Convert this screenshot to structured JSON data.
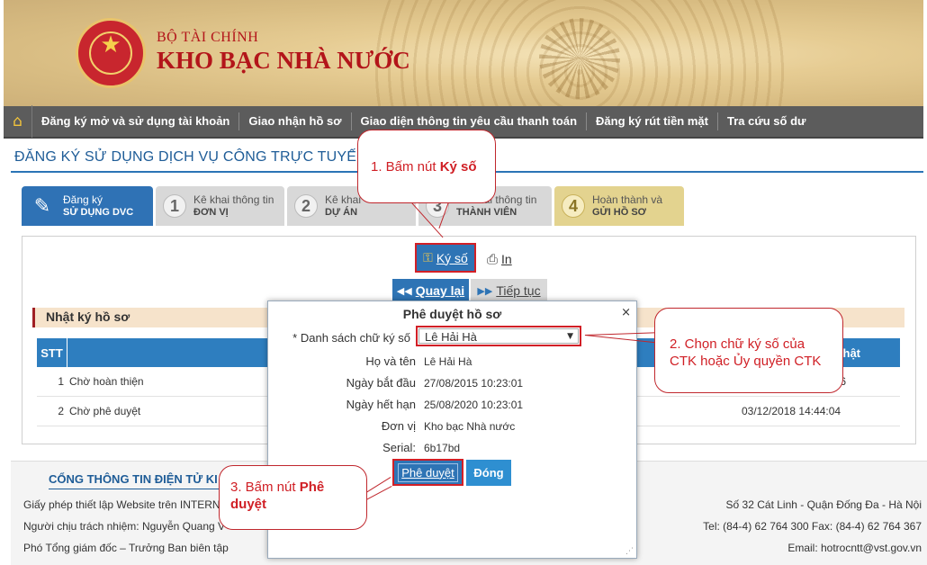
{
  "header": {
    "ministry": "BỘ TÀI CHÍNH",
    "agency": "KHO BẠC NHÀ NƯỚC"
  },
  "nav": {
    "home_icon": "home-icon",
    "items": [
      "Đăng ký mở và sử dụng tài khoản",
      "Giao nhận hồ sơ",
      "Giao diện thông tin yêu cầu thanh toán",
      "Đăng ký rút tiền mặt",
      "Tra cứu số dư"
    ]
  },
  "page_title": "ĐĂNG KÝ SỬ DỤNG DỊCH VỤ CÔNG TRỰC TUYẾN",
  "steps": [
    {
      "num": "",
      "line1": "Đăng ký",
      "line2": "SỬ DỤNG DVC"
    },
    {
      "num": "1",
      "line1": "Kê khai thông tin",
      "line2": "ĐƠN VỊ"
    },
    {
      "num": "2",
      "line1": "Kê khai",
      "line2": "DỰ ÁN"
    },
    {
      "num": "3",
      "line1": "Kê khai thông tin",
      "line2": "THÀNH VIÊN"
    },
    {
      "num": "4",
      "line1": "Hoàn thành và",
      "line2": "GỬI HỒ SƠ"
    }
  ],
  "toolbar": {
    "sign_label": "Ký số",
    "print_label": "In",
    "back_label": "Quay lại",
    "next_label": "Tiếp tục"
  },
  "log": {
    "title": "Nhật ký hồ sơ",
    "columns": [
      "STT",
      "Nhật"
    ],
    "rows": [
      {
        "stt": "1",
        "status": "Chờ hoàn thiện",
        "time": "6"
      },
      {
        "stt": "2",
        "status": "Chờ phê duyệt",
        "time": "03/12/2018 14:44:04"
      }
    ]
  },
  "footer": {
    "title": "CỔNG THÔNG TIN ĐIỆN TỬ KI",
    "left": [
      "Giấy phép thiết lập Website trên INTERN",
      "Người chịu trách nhiệm: Nguyễn Quang V",
      "Phó Tổng giám đốc – Trưởng Ban biên tập"
    ],
    "right": [
      "Số 32 Cát Linh - Quận Đống Đa - Hà Nội",
      "Tel: (84-4) 62 764 300 Fax: (84-4) 62 764 367",
      "Email: hotrocntt@vst.gov.vn"
    ]
  },
  "modal": {
    "title": "Phê duyệt hồ sơ",
    "close": "×",
    "signature_list_label": "* Danh sách chữ ký số",
    "signature_selected": "Lê Hải Hà",
    "fields": [
      {
        "label": "Họ và tên",
        "value": "Lê Hải Hà"
      },
      {
        "label": "Ngày bắt đầu",
        "value": "27/08/2015 10:23:01"
      },
      {
        "label": "Ngày hết hạn",
        "value": "25/08/2020 10:23:01"
      },
      {
        "label": "Đơn vị",
        "value": "Kho bạc Nhà nước"
      },
      {
        "label": "Serial:",
        "value": "6b17bd"
      }
    ],
    "approve_label": "Phê duyệt",
    "close_label": "Đóng"
  },
  "callouts": {
    "c1_text": "1. Bấm nút ",
    "c1_bold": "Ký số",
    "c2_text": "2. Chọn chữ ký số của CTK hoặc Ủy quyền CTK",
    "c3_text": "3. Bấm nút ",
    "c3_bold": "Phê duyệt"
  }
}
